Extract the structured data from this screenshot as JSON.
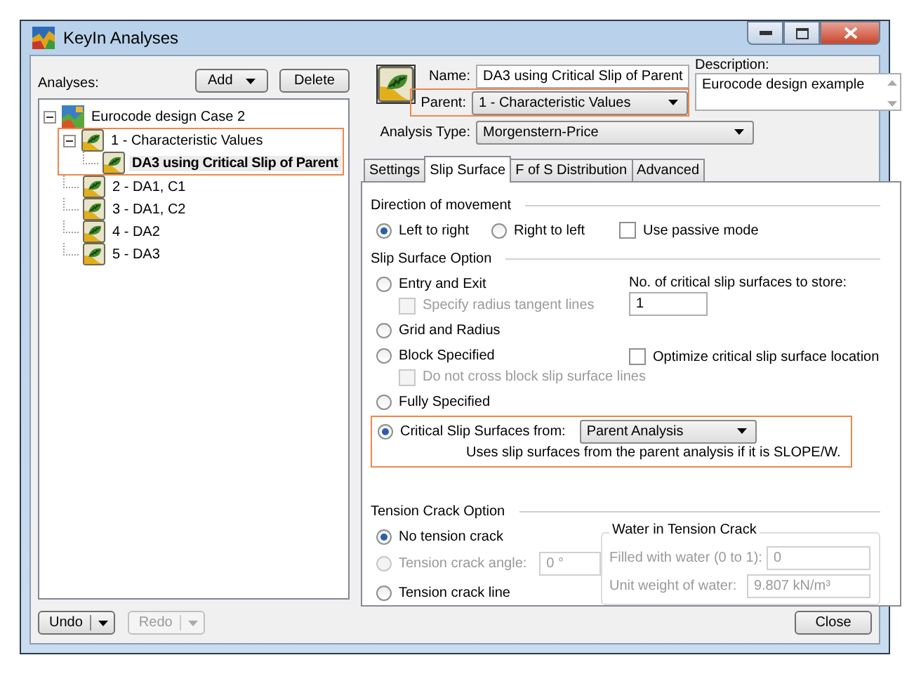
{
  "window": {
    "title": "KeyIn Analyses"
  },
  "analyses": {
    "label": "Analyses:",
    "add_button": "Add",
    "delete_button": "Delete",
    "tree": [
      {
        "label": "Eurocode design Case 2",
        "kind": "project",
        "expanded": true,
        "selected": false,
        "highlighted": false,
        "children": [
          {
            "label": "1 - Characteristic Values",
            "kind": "analysis",
            "expanded": true,
            "selected": false,
            "highlighted": true,
            "children": [
              {
                "label": "DA3 using Critical Slip of Parent",
                "kind": "analysis",
                "selected": true,
                "highlighted": false
              }
            ]
          },
          {
            "label": "2 - DA1, C1",
            "kind": "analysis",
            "selected": false,
            "highlighted": false
          },
          {
            "label": "3 - DA1, C2",
            "kind": "analysis",
            "selected": false,
            "highlighted": false
          },
          {
            "label": "4 - DA2",
            "kind": "analysis",
            "selected": false,
            "highlighted": false
          },
          {
            "label": "5 - DA3",
            "kind": "analysis",
            "selected": false,
            "highlighted": false
          }
        ]
      }
    ]
  },
  "header": {
    "name": {
      "label": "Name:",
      "value": "DA3 using Critical Slip of Parent"
    },
    "parent": {
      "label": "Parent:",
      "value": "1 - Characteristic Values",
      "highlighted": true
    },
    "description": {
      "label": "Description:",
      "value": "Eurocode design example"
    },
    "analysis_type": {
      "label": "Analysis Type:",
      "value": "Morgenstern-Price"
    }
  },
  "tabs": [
    {
      "label": "Settings",
      "selected": false
    },
    {
      "label": "Slip Surface",
      "selected": true
    },
    {
      "label": "F of S Distribution",
      "selected": false
    },
    {
      "label": "Advanced",
      "selected": false
    }
  ],
  "direction": {
    "title": "Direction of movement",
    "options": [
      {
        "label": "Left to right",
        "selected": true
      },
      {
        "label": "Right to left",
        "selected": false
      }
    ],
    "passive": {
      "label": "Use passive mode",
      "checked": false
    }
  },
  "slip_surface_option": {
    "title": "Slip Surface Option",
    "methods": [
      {
        "kind": "radio",
        "label": "Entry and Exit",
        "selected": false,
        "children": [
          {
            "label": "Specify radius tangent lines",
            "checked": false,
            "disabled": true
          }
        ]
      },
      {
        "kind": "radio",
        "label": "Grid and Radius",
        "selected": false
      },
      {
        "kind": "radio",
        "label": "Block Specified",
        "selected": false,
        "children": [
          {
            "label": "Do not cross block slip surface lines",
            "checked": false,
            "disabled": true
          }
        ]
      },
      {
        "kind": "radio",
        "label": "Fully Specified",
        "selected": false
      },
      {
        "kind": "combo_radio",
        "label": "Critical Slip Surfaces from:",
        "selected": true,
        "value": "Parent Analysis",
        "note": "Uses slip surfaces from the parent analysis if it is SLOPE/W.",
        "highlighted": true
      }
    ],
    "store_count": {
      "label": "No. of critical slip surfaces to store:",
      "value": "1"
    },
    "optimize": {
      "label": "Optimize critical slip surface location",
      "checked": false
    }
  },
  "tension_crack": {
    "title": "Tension Crack Option",
    "options": [
      {
        "kind": "radio",
        "label": "No tension crack",
        "selected": true,
        "disabled": false
      },
      {
        "kind": "radio_field",
        "label": "Tension crack angle:",
        "selected": false,
        "disabled": true,
        "value": "0 °"
      },
      {
        "kind": "radio",
        "label": "Tension crack line",
        "selected": false,
        "disabled": false
      }
    ],
    "water": {
      "title": "Water in Tension Crack",
      "fields": [
        {
          "label": "Filled with water (0 to 1):",
          "value": "0",
          "disabled": true
        },
        {
          "label": "Unit weight of water:",
          "value": "9.807 kN/m³",
          "disabled": true
        }
      ]
    }
  },
  "footer": {
    "undo": {
      "label": "Undo",
      "disabled": false
    },
    "redo": {
      "label": "Redo",
      "disabled": true
    },
    "close": "Close"
  }
}
